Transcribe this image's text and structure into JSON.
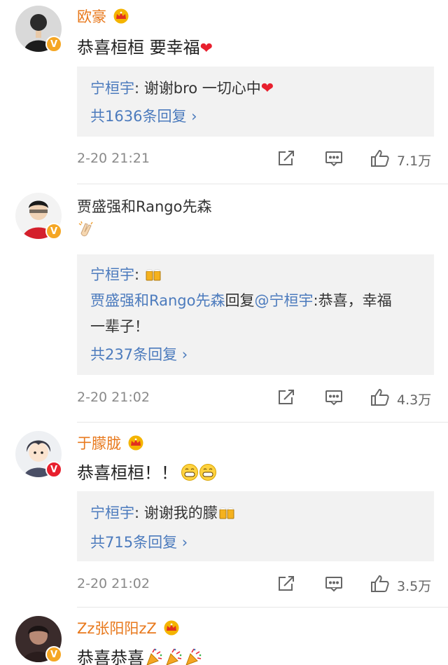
{
  "comments": [
    {
      "username": "欧豪",
      "text": "恭喜桓桓  要幸福",
      "text_emoji": "heart",
      "reply_user": "宁桓宇",
      "reply_text": "谢谢bro 一切心中",
      "reply_emoji": "heart",
      "more_replies": "共1636条回复 ›",
      "time": "2-20 21:21",
      "likes": "7.1万"
    },
    {
      "username": "贾盛强和Rango先森",
      "text_emoji": "clapping-hands",
      "reply_user": "宁桓宇",
      "reply_emoji": "cheers-beer",
      "nested_user": "贾盛强和Rango先森",
      "nested_word": "回复",
      "nested_mention": "@宁桓宇",
      "nested_text_1": ":恭喜，幸福",
      "nested_text_2": "一辈子！",
      "more_replies": "共237条回复 ›",
      "time": "2-20 21:02",
      "likes": "4.3万"
    },
    {
      "username": "于朦胧",
      "text": "恭喜桓桓！！",
      "text_emoji": "grin-face",
      "reply_user": "宁桓宇",
      "reply_text": "谢谢我的朦",
      "reply_emoji": "cheers-beer",
      "more_replies": "共715条回复 ›",
      "time": "2-20 21:02",
      "likes": "3.5万"
    },
    {
      "username": "Zz张阳阳zZ",
      "text": "恭喜恭喜",
      "text_emoji": "party-popper"
    }
  ],
  "colors": {
    "vip_name": "#e8791d",
    "link_blue": "#4c7bbd",
    "reply_bg": "#f2f2f2",
    "verified_badge": "#f5a623"
  },
  "verified_badge": "V"
}
